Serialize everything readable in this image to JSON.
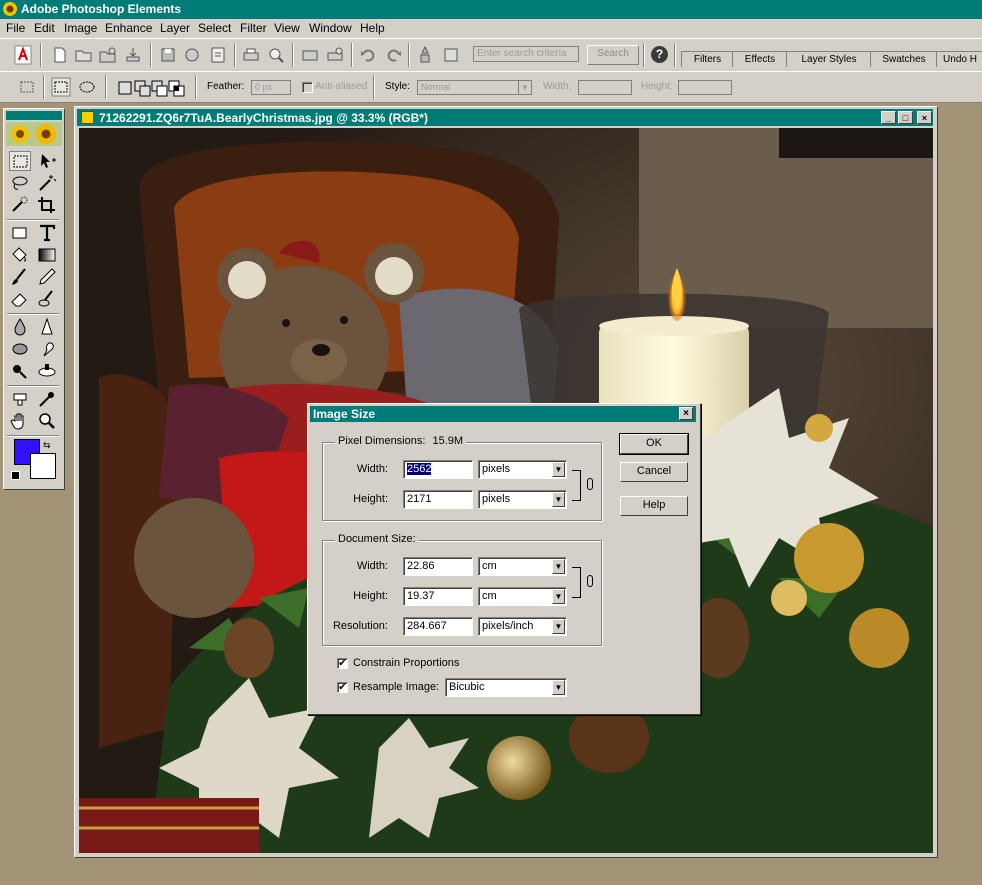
{
  "app": {
    "title": "Adobe Photoshop Elements"
  },
  "menu": [
    "File",
    "Edit",
    "Image",
    "Enhance",
    "Layer",
    "Select",
    "Filter",
    "View",
    "Window",
    "Help"
  ],
  "toolbar": {
    "search_placeholder": "Enter search criteria",
    "search_label": "Search",
    "help_label": "?",
    "palette_tabs": [
      "Filters",
      "Effects",
      "Layer Styles",
      "Swatches",
      "Undo H"
    ]
  },
  "options_bar": {
    "feather_label": "Feather:",
    "feather_value": "0 px",
    "anti_aliased_label": "Anti-aliased",
    "style_label": "Style:",
    "style_value": "Normal",
    "width_label": "Width:",
    "height_label": "Height:"
  },
  "toolbox": {
    "foreground_color": "#3010ff",
    "background_color": "#ffffff"
  },
  "document": {
    "title": "71262291.ZQ6r7TuA.BearlyChristmas.jpg @ 33.3% (RGB*)",
    "window_buttons": [
      "_",
      "□",
      "×"
    ]
  },
  "dialog": {
    "title": "Image Size",
    "close_label": "×",
    "pixel_dimensions": {
      "label": "Pixel Dimensions:",
      "size": "15.9M",
      "width_label": "Width:",
      "width_value": "2562",
      "width_unit": "pixels",
      "height_label": "Height:",
      "height_value": "2171",
      "height_unit": "pixels"
    },
    "document_size": {
      "label": "Document Size:",
      "width_label": "Width:",
      "width_value": "22.86",
      "width_unit": "cm",
      "height_label": "Height:",
      "height_value": "19.37",
      "height_unit": "cm",
      "resolution_label": "Resolution:",
      "resolution_value": "284.667",
      "resolution_unit": "pixels/inch"
    },
    "constrain_label": "Constrain Proportions",
    "constrain_checked": "✔",
    "resample_label": "Resample Image:",
    "resample_checked": "✔",
    "resample_value": "Bicubic",
    "buttons": {
      "ok": "OK",
      "cancel": "Cancel",
      "help": "Help"
    }
  }
}
